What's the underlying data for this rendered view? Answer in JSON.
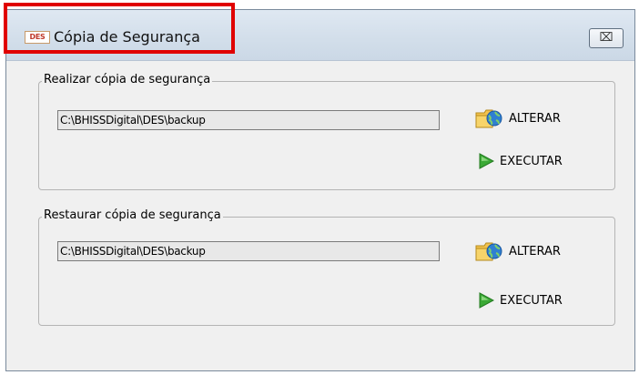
{
  "window": {
    "title": "Cópia de Segurança",
    "icon_text": "DES",
    "close_symbol": "⌧"
  },
  "backup": {
    "legend": "Realizar cópia de segurança",
    "path": "C:\\BHISSDigital\\DES\\backup",
    "alter_label": "ALTERAR",
    "execute_label": "EXECUTAR"
  },
  "restore": {
    "legend": "Restaurar cópia de segurança",
    "path": "C:\\BHISSDigital\\DES\\backup",
    "alter_label": "ALTERAR",
    "execute_label": "EXECUTAR"
  },
  "icons": {
    "app": "des-app-icon",
    "close": "close-icon",
    "alter": "folder-globe-icon",
    "execute": "play-arrow-icon"
  },
  "colors": {
    "highlight": "#e00000",
    "play_green": "#3aa935",
    "field_bg": "#e8e8e8"
  }
}
